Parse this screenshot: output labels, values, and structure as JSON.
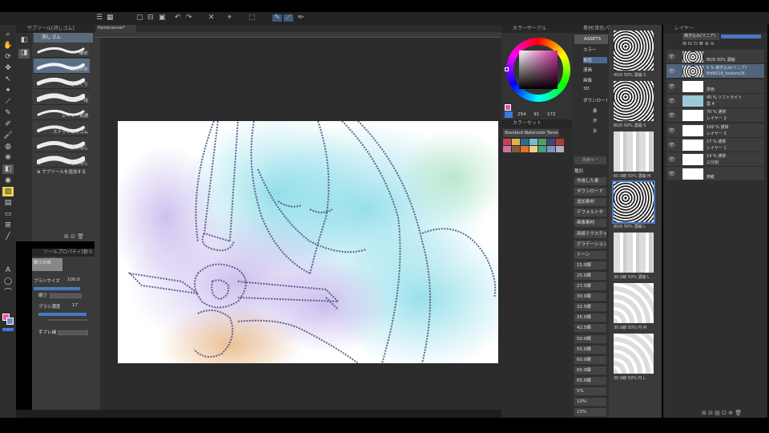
{
  "tool_palette": {
    "header": "サブツール[消しゴム]",
    "active_group": "消しゴム",
    "brushes": [
      {
        "label": "硬め"
      },
      {
        "label": "軟らかめ"
      },
      {
        "label": "ざっくり"
      },
      {
        "label": "ベクター用"
      },
      {
        "label": "レイヤー貫通"
      },
      {
        "label": "スナップ消しゴム"
      },
      {
        "label": "練り消し"
      },
      {
        "label": "粗り消し"
      }
    ],
    "add_subtool": "サブツールを追加する"
  },
  "tool_property": {
    "header": "ツールプロパティ[軟らかめ]",
    "preset_name": "軟らかめ",
    "brush_size_label": "ブラシサイズ",
    "brush_size_value": "100.0",
    "hardness_label": "硬さ",
    "density_label": "ブラシ濃度",
    "density_value": "17",
    "flow_label": "手ブレ補"
  },
  "canvas": {
    "tab_title": "flamecanvas*"
  },
  "color_wheel": {
    "header": "カラーサークル",
    "hsv": [
      "254",
      "91",
      "172"
    ],
    "ring_stops": [
      "#ff0000",
      "#ffff00",
      "#00ff00",
      "#00ffff",
      "#0000ff",
      "#ff00ff",
      "#ff0000"
    ],
    "selected_color": "#a8305a"
  },
  "color_set": {
    "header": "カラーセット",
    "set_name": "Standard Watercolor Tones",
    "swatches": [
      "#c4405a",
      "#e0b050",
      "#2f6a8a",
      "#74c0c8",
      "#5a9a6a",
      "#3a4a7a",
      "#b03a3a",
      "#d070a0",
      "#8a5a3a",
      "#e07030",
      "#f0d080",
      "#40a080",
      "#8090c0",
      "#b0b0c0"
    ]
  },
  "material": {
    "header": "素材[単色パターン]",
    "asset_label": "ASSETS",
    "tree": [
      "カラー",
      "単色",
      "漫画",
      "画像",
      "3D",
      "ダウンロード",
      "素",
      "水",
      "水"
    ],
    "search_placeholder": "検索キー",
    "category_label": "種別",
    "categories": [
      "作成した素",
      "ダウンロード",
      "追加素材",
      "デフォルトタ",
      "画像素材",
      "用紙テクスチャ",
      "グラデーション",
      "トーン",
      "15.0線",
      "25.0線",
      "27.5線",
      "30.0線",
      "32.5線",
      "35.0線",
      "42.5線",
      "50.0線",
      "55.0線",
      "60.0線",
      "65.0線",
      "85.0線",
      "5%",
      "10%",
      "15%"
    ],
    "tiles": [
      {
        "label": "40/0 50% 濃縮 S"
      },
      {
        "label": "80/0 50% 濃縮 S"
      },
      {
        "label": "60.0線 50% 濃縮 M"
      },
      {
        "label": "80/0 50% 濃縮 L"
      },
      {
        "label": "30.0線 50% 濃縮 L"
      },
      {
        "label": "30.0線 50% 円 M"
      },
      {
        "label": "30.0線 50% 円 L"
      }
    ]
  },
  "layers": {
    "header": "レイヤー",
    "blend_mode": "焼き込み(リニア)",
    "rows": [
      {
        "l1": "",
        "l2": "80/0 50% 濃縮"
      },
      {
        "l1": "5 % 焼き込み(リニア)",
        "l2": "MdN218_texture16"
      },
      {
        "l1": "",
        "l2": "単色"
      },
      {
        "l1": "45 % ソフトライト",
        "l2": "雲 4"
      },
      {
        "l1": "70 % 通常",
        "l2": "レイヤー 2"
      },
      {
        "l1": "100 % 通常",
        "l2": "レイヤー 3"
      },
      {
        "l1": "17 % 通常",
        "l2": "レイヤー 1"
      },
      {
        "l1": "14 % 通常",
        "l2": "三分割"
      },
      {
        "l1": "",
        "l2": "用紙"
      }
    ]
  }
}
